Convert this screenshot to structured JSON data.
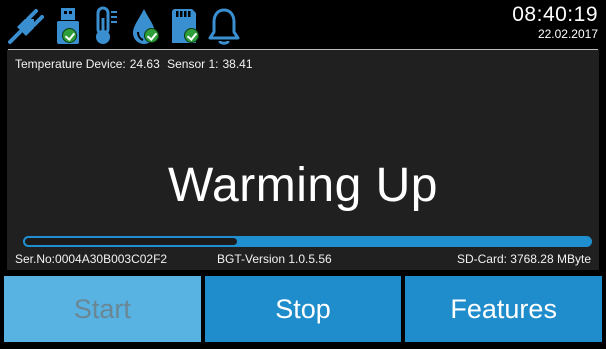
{
  "status_bar": {
    "icons": [
      {
        "name": "power-plug-icon",
        "color": "#3a8fd0"
      },
      {
        "name": "usb-stick-icon",
        "color": "#3a8fd0",
        "checked": true
      },
      {
        "name": "thermometer-icon",
        "color": "#3a8fd0"
      },
      {
        "name": "water-drop-icon",
        "color": "#3a8fd0",
        "checked": true
      },
      {
        "name": "sd-card-icon",
        "color": "#3a8fd0",
        "checked": true
      },
      {
        "name": "bell-icon",
        "color": "#3a8fd0"
      }
    ],
    "time": "08:40:19",
    "date": "22.02.2017"
  },
  "main": {
    "temperature_device_label": "Temperature Device:",
    "temperature_device_value": "24.63",
    "sensor1_label": "Sensor 1:",
    "sensor1_value": "38.41",
    "status": "Warming Up",
    "progress_fraction": 0.38,
    "serial_number": "Ser.No:0004A30B003C02F2",
    "version": "BGT-Version 1.0.5.56",
    "sd_card": "SD-Card: 3768.28 MByte"
  },
  "buttons": {
    "start_label": "Start",
    "stop_label": "Stop",
    "features_label": "Features"
  },
  "colors": {
    "accent": "#1f8dcb",
    "disabled_button": "#58b2e2",
    "panel_background": "#202020",
    "check_green": "#2e9e3a"
  }
}
